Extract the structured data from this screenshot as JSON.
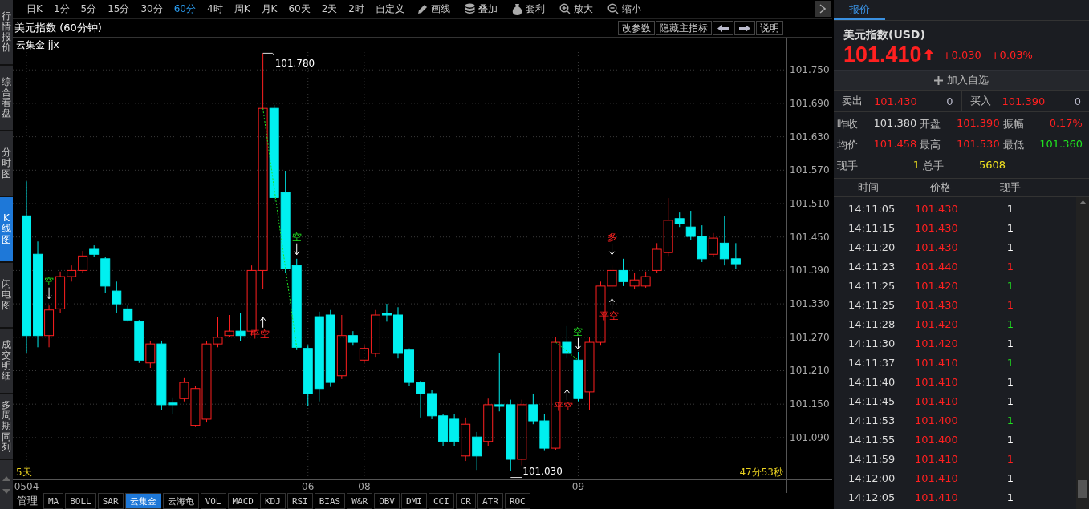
{
  "sidebar": {
    "items": [
      {
        "label": "行情报价",
        "selected": false
      },
      {
        "label": "综合看盘",
        "selected": false
      },
      {
        "label": "分时图",
        "selected": false
      },
      {
        "label": "K线图",
        "selected": true
      },
      {
        "label": "闪电图",
        "selected": false
      },
      {
        "label": "成交明细",
        "selected": false
      },
      {
        "label": "多周期同列",
        "selected": false
      }
    ]
  },
  "toolbar": {
    "periods": [
      {
        "label": "日K",
        "selected": false
      },
      {
        "label": "1分",
        "selected": false
      },
      {
        "label": "5分",
        "selected": false
      },
      {
        "label": "15分",
        "selected": false
      },
      {
        "label": "30分",
        "selected": false
      },
      {
        "label": "60分",
        "selected": true
      },
      {
        "label": "4时",
        "selected": false
      },
      {
        "label": "周K",
        "selected": false
      },
      {
        "label": "月K",
        "selected": false
      },
      {
        "label": "60天",
        "selected": false
      },
      {
        "label": "2天",
        "selected": false
      },
      {
        "label": "2时",
        "selected": false
      },
      {
        "label": "自定义",
        "selected": false
      }
    ],
    "tools": [
      {
        "label": "画线",
        "kind": "draw"
      },
      {
        "label": "叠加",
        "kind": "overlay"
      },
      {
        "label": "套利",
        "kind": "arbitrage"
      },
      {
        "label": "放大",
        "kind": "zoom-in"
      },
      {
        "label": "缩小",
        "kind": "zoom-out"
      }
    ]
  },
  "chart": {
    "title": "美元指数 (60分钟)",
    "buttons": [
      {
        "kind": "text",
        "label": "改参数"
      },
      {
        "kind": "text",
        "label": "隐藏主指标"
      },
      {
        "kind": "left"
      },
      {
        "kind": "right"
      },
      {
        "kind": "text",
        "label": "说明"
      }
    ],
    "indicator": "云集金 jjx",
    "chart_data": {
      "type": "candlestick",
      "grid": true,
      "ylim": [
        101.015,
        101.782
      ],
      "yticks": [
        {
          "value": 101.75,
          "label": "101.750"
        },
        {
          "value": 101.69,
          "label": "101.690"
        },
        {
          "value": 101.63,
          "label": "101.630"
        },
        {
          "value": 101.57,
          "label": "101.570"
        },
        {
          "value": 101.51,
          "label": "101.510"
        },
        {
          "value": 101.45,
          "label": "101.450"
        },
        {
          "value": 101.39,
          "label": "101.390"
        },
        {
          "value": 101.33,
          "label": "101.330"
        },
        {
          "value": 101.27,
          "label": "101.270"
        },
        {
          "value": 101.21,
          "label": "101.210"
        },
        {
          "value": 101.15,
          "label": "101.150"
        },
        {
          "value": 101.09,
          "label": "101.090"
        }
      ],
      "categories": [
        "0504",
        null,
        null,
        null,
        null,
        null,
        null,
        null,
        null,
        null,
        null,
        null,
        null,
        null,
        null,
        null,
        null,
        null,
        null,
        null,
        null,
        null,
        null,
        null,
        null,
        "06",
        null,
        null,
        null,
        null,
        "08",
        null,
        null,
        null,
        null,
        null,
        null,
        null,
        null,
        null,
        null,
        null,
        null,
        null,
        null,
        null,
        null,
        null,
        null,
        "09",
        null,
        null,
        null,
        null,
        null,
        null,
        null,
        null,
        null,
        null,
        null,
        null,
        null,
        null,
        null,
        null,
        null,
        null
      ],
      "ohlc": [
        [
          101.488,
          101.55,
          101.241,
          101.273
        ],
        [
          101.419,
          101.442,
          101.252,
          101.273
        ],
        [
          101.273,
          101.327,
          101.252,
          101.319
        ],
        [
          101.321,
          101.388,
          101.313,
          101.379
        ],
        [
          101.379,
          101.399,
          101.37,
          101.39
        ],
        [
          101.39,
          101.425,
          101.385,
          101.416
        ],
        [
          101.428,
          101.435,
          101.414,
          101.419
        ],
        [
          101.411,
          101.414,
          101.349,
          101.362
        ],
        [
          101.353,
          101.37,
          101.313,
          101.33
        ],
        [
          101.321,
          101.327,
          101.298,
          101.301
        ],
        [
          101.298,
          101.301,
          101.224,
          101.229
        ],
        [
          101.224,
          101.264,
          101.215,
          101.258
        ],
        [
          101.258,
          101.264,
          101.14,
          101.149
        ],
        [
          101.152,
          101.162,
          101.133,
          101.149
        ],
        [
          101.16,
          101.198,
          101.155,
          101.189
        ],
        [
          101.112,
          101.183,
          101.109,
          101.178
        ],
        [
          101.123,
          101.264,
          101.117,
          101.258
        ],
        [
          101.258,
          101.307,
          101.252,
          101.27
        ],
        [
          101.273,
          101.31,
          101.27,
          101.281
        ],
        [
          101.281,
          101.313,
          101.263,
          101.273
        ],
        [
          101.281,
          101.399,
          101.273,
          101.39
        ],
        [
          101.39,
          101.78,
          101.356,
          101.681
        ],
        [
          101.681,
          101.687,
          101.514,
          101.521
        ],
        [
          101.53,
          101.569,
          101.385,
          101.393
        ],
        [
          101.399,
          101.411,
          101.247,
          101.252
        ],
        [
          101.25,
          101.255,
          101.147,
          101.169
        ],
        [
          101.307,
          101.316,
          101.155,
          101.178
        ],
        [
          101.31,
          101.319,
          101.181,
          101.189
        ],
        [
          101.201,
          101.31,
          101.195,
          101.273
        ],
        [
          101.273,
          101.281,
          101.255,
          101.261
        ],
        [
          101.229,
          101.255,
          101.224,
          101.25
        ],
        [
          101.241,
          101.319,
          101.235,
          101.31
        ],
        [
          101.313,
          101.33,
          101.298,
          101.31
        ],
        [
          101.31,
          101.324,
          101.232,
          101.241
        ],
        [
          101.247,
          101.25,
          101.183,
          101.189
        ],
        [
          101.189,
          101.192,
          101.126,
          101.169
        ],
        [
          101.169,
          101.175,
          101.123,
          101.129
        ],
        [
          101.129,
          101.132,
          101.074,
          101.083
        ],
        [
          101.123,
          101.132,
          101.074,
          101.083
        ],
        [
          101.057,
          101.126,
          101.048,
          101.114
        ],
        [
          101.091,
          101.1,
          101.032,
          101.057
        ],
        [
          101.083,
          101.16,
          101.074,
          101.149
        ],
        [
          101.149,
          101.241,
          101.137,
          101.146
        ],
        [
          101.149,
          101.158,
          101.03,
          101.051
        ],
        [
          101.051,
          101.158,
          101.04,
          101.149
        ],
        [
          101.149,
          101.169,
          101.114,
          101.12
        ],
        [
          101.12,
          101.132,
          101.066,
          101.071
        ],
        [
          101.071,
          101.27,
          101.068,
          101.261
        ],
        [
          101.261,
          101.29,
          101.232,
          101.241
        ],
        [
          101.229,
          101.244,
          101.155,
          101.16
        ],
        [
          101.172,
          101.27,
          101.14,
          101.261
        ],
        [
          101.261,
          101.37,
          101.255,
          101.362
        ],
        [
          101.362,
          101.399,
          101.356,
          101.39
        ],
        [
          101.39,
          101.411,
          101.362,
          101.37
        ],
        [
          101.362,
          101.385,
          101.356,
          101.373
        ],
        [
          101.362,
          101.388,
          101.359,
          101.379
        ],
        [
          101.39,
          101.439,
          101.385,
          101.428
        ],
        [
          101.422,
          101.52,
          101.416,
          101.48
        ],
        [
          101.483,
          101.494,
          101.468,
          101.474
        ],
        [
          101.468,
          101.497,
          101.445,
          101.451
        ],
        [
          101.451,
          101.471,
          101.405,
          101.411
        ],
        [
          101.419,
          101.457,
          101.414,
          101.448
        ],
        [
          101.439,
          101.488,
          101.399,
          101.411
        ],
        [
          101.411,
          101.439,
          101.393,
          101.402
        ],
        null,
        null,
        null,
        null
      ]
    },
    "markers": [
      {
        "kind": "high",
        "label": "101.780"
      },
      {
        "kind": "low",
        "label": "101.030"
      },
      {
        "kind": "sell",
        "label": "空"
      },
      {
        "kind": "sell",
        "label": "空"
      },
      {
        "kind": "sell",
        "label": "空"
      },
      {
        "kind": "buy",
        "label": "多"
      },
      {
        "kind": "cover",
        "label": "平空"
      },
      {
        "kind": "cover",
        "label": "平空"
      },
      {
        "kind": "cover",
        "label": "平空"
      }
    ],
    "range_label": "5天",
    "countdown": "47分53秒"
  },
  "indicator_tabs": [
    {
      "label": "管理",
      "selected": false
    },
    {
      "label": "MA",
      "selected": false
    },
    {
      "label": "BOLL",
      "selected": false
    },
    {
      "label": "SAR",
      "selected": false
    },
    {
      "label": "云集金",
      "selected": true
    },
    {
      "label": "云海龟",
      "selected": false
    },
    {
      "label": "VOL",
      "selected": false
    },
    {
      "label": "MACD",
      "selected": false
    },
    {
      "label": "KDJ",
      "selected": false
    },
    {
      "label": "RSI",
      "selected": false
    },
    {
      "label": "BIAS",
      "selected": false
    },
    {
      "label": "W&R",
      "selected": false
    },
    {
      "label": "OBV",
      "selected": false
    },
    {
      "label": "DMI",
      "selected": false
    },
    {
      "label": "CCI",
      "selected": false
    },
    {
      "label": "CR",
      "selected": false
    },
    {
      "label": "ATR",
      "selected": false
    },
    {
      "label": "ROC",
      "selected": false
    }
  ],
  "quote": {
    "tabs": [
      {
        "label": "报价",
        "selected": true
      }
    ],
    "name": "美元指数(USD)",
    "price": "101.410",
    "rising": true,
    "change": "+0.030",
    "change_pct": "+0.03%",
    "add_button": "加入自选",
    "book": [
      {
        "label": "卖出",
        "price": "101.430",
        "volume": "0"
      },
      {
        "label": "买入",
        "price": "101.390",
        "volume": "0"
      }
    ],
    "stats": [
      {
        "label": "昨收",
        "value": "101.380",
        "color": "#d8d8d8"
      },
      {
        "label": "开盘",
        "value": "101.390",
        "color": "#ff2020"
      },
      {
        "label": "振幅",
        "value": "0.17%",
        "color": "#ff2020"
      },
      {
        "label": "均价",
        "value": "101.458",
        "color": "#ff2020"
      },
      {
        "label": "最高",
        "value": "101.530",
        "color": "#ff2020"
      },
      {
        "label": "最低",
        "value": "101.360",
        "color": "#20e020"
      },
      {
        "label": "现手",
        "value": "1",
        "color": "#f0e020"
      },
      {
        "label": "总手",
        "value": "5608",
        "color": "#f0e020"
      }
    ],
    "trades": {
      "columns": [
        "时间",
        "价格",
        "现手"
      ],
      "rows": [
        {
          "time": "14:11:05",
          "price": "101.430",
          "volume": "1",
          "color": "#ffffff"
        },
        {
          "time": "14:11:15",
          "price": "101.430",
          "volume": "1",
          "color": "#ffffff"
        },
        {
          "time": "14:11:20",
          "price": "101.430",
          "volume": "1",
          "color": "#ffffff"
        },
        {
          "time": "14:11:23",
          "price": "101.440",
          "volume": "1",
          "color": "#ff2020"
        },
        {
          "time": "14:11:25",
          "price": "101.420",
          "volume": "1",
          "color": "#20e020"
        },
        {
          "time": "14:11:25",
          "price": "101.430",
          "volume": "1",
          "color": "#ff2020"
        },
        {
          "time": "14:11:28",
          "price": "101.420",
          "volume": "1",
          "color": "#20e020"
        },
        {
          "time": "14:11:30",
          "price": "101.420",
          "volume": "1",
          "color": "#ffffff"
        },
        {
          "time": "14:11:37",
          "price": "101.410",
          "volume": "1",
          "color": "#20e020"
        },
        {
          "time": "14:11:40",
          "price": "101.410",
          "volume": "1",
          "color": "#ffffff"
        },
        {
          "time": "14:11:45",
          "price": "101.410",
          "volume": "1",
          "color": "#ffffff"
        },
        {
          "time": "14:11:53",
          "price": "101.400",
          "volume": "1",
          "color": "#20e020"
        },
        {
          "time": "14:11:55",
          "price": "101.400",
          "volume": "1",
          "color": "#ffffff"
        },
        {
          "time": "14:11:59",
          "price": "101.410",
          "volume": "1",
          "color": "#ff2020"
        },
        {
          "time": "14:12:00",
          "price": "101.410",
          "volume": "1",
          "color": "#ffffff"
        },
        {
          "time": "14:12:05",
          "price": "101.410",
          "volume": "1",
          "color": "#ffffff"
        }
      ]
    }
  }
}
